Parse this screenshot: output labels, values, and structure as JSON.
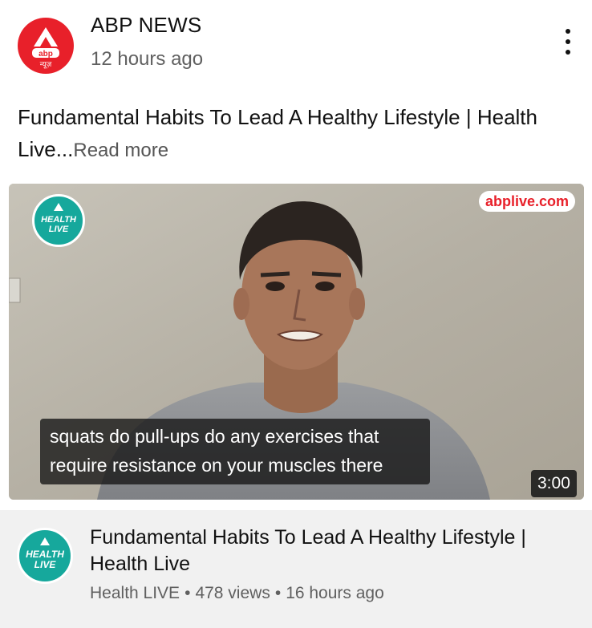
{
  "post": {
    "channel_name": "ABP NEWS",
    "time": "12 hours ago",
    "avatar_text_top": "abp",
    "avatar_text_bottom": "न्यूज़",
    "text": "Fundamental Habits To Lead A Healthy Lifestyle | Health Live...",
    "read_more": "Read more"
  },
  "video": {
    "logo_line1": "HEALTH",
    "logo_line2": "LIVE",
    "source_tag": "abplive.com",
    "caption_line1": "squats do pull-ups do any exercises that",
    "caption_line2": "require resistance on your muscles there",
    "duration": "3:00",
    "title": "Fundamental Habits To Lead A Healthy Lifestyle | Health Live",
    "channel": "Health LIVE",
    "views": "478 views",
    "age": "16 hours ago",
    "separator": "•"
  },
  "colors": {
    "abp_red": "#e8202a",
    "health_live_teal": "#16a89c",
    "meta_gray": "#606060"
  },
  "icons": {
    "more": "kebab-menu-icon"
  }
}
